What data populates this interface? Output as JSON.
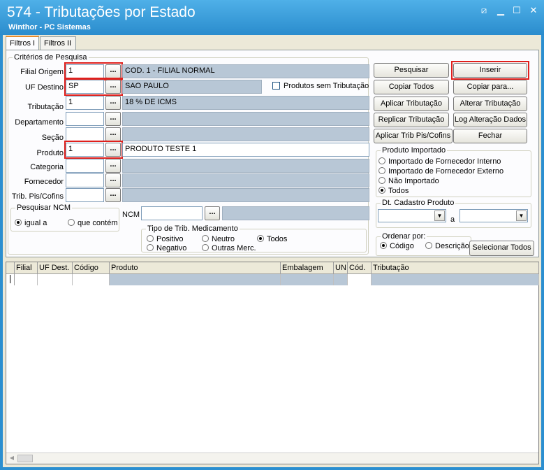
{
  "window": {
    "title": "574 - Tributações por Estado",
    "subtitle": "Winthor - PC Sistemas",
    "restore_icon": "restore-icon",
    "minimize_icon": "minimize-icon",
    "maximize_icon": "maximize-icon",
    "close_icon": "close-icon"
  },
  "tabs": [
    {
      "label": "Filtros I",
      "active": true
    },
    {
      "label": "Filtros II",
      "active": false
    }
  ],
  "criterios": {
    "group_label": "Critérios de Pesquisa",
    "filial_origem": {
      "label": "Filial Origem",
      "value": "1",
      "desc": "COD. 1 - FILIAL NORMAL"
    },
    "uf_destino": {
      "label": "UF Destino",
      "value": "SP",
      "desc": "SAO PAULO"
    },
    "produtos_sem_trib": "Produtos sem Tributação",
    "tributacao": {
      "label": "Tributação",
      "value": "1",
      "desc": "18 % DE ICMS"
    },
    "departamento": {
      "label": "Departamento",
      "value": "",
      "desc": ""
    },
    "secao": {
      "label": "Seção",
      "value": "",
      "desc": ""
    },
    "produto": {
      "label": "Produto",
      "value": "1",
      "desc": "PRODUTO TESTE 1"
    },
    "categoria": {
      "label": "Categoria",
      "value": "",
      "desc": ""
    },
    "fornecedor": {
      "label": "Fornecedor",
      "value": "",
      "desc": ""
    },
    "trib_pis": {
      "label": "Trib. Pis/Cofins",
      "value": "",
      "desc": ""
    },
    "ellipsis": "..."
  },
  "pesquisar_ncm": {
    "label": "Pesquisar NCM",
    "igual": "igual a",
    "contem": "que contém",
    "ncm_label": "NCM",
    "ncm_value": ""
  },
  "tipo_trib": {
    "label": "Tipo de Trib. Medicamento",
    "positivo": "Positivo",
    "neutro": "Neutro",
    "todos": "Todos",
    "negativo": "Negativo",
    "outras": "Outras Merc."
  },
  "buttons": {
    "pesquisar": "Pesquisar",
    "inserir": "Inserir",
    "copiar_todos": "Copiar Todos",
    "copiar_para": "Copiar para...",
    "aplicar_trib": "Aplicar Tributação",
    "alterar_trib": "Alterar Tributação",
    "replicar_trib": "Replicar Tributação",
    "log_alteracao": "Log Alteração Dados",
    "aplicar_pis": "Aplicar Trib Pis/Cofins",
    "fechar": "Fechar",
    "selecionar_todos": "Selecionar Todos"
  },
  "produto_importado": {
    "label": "Produto Importado",
    "opt1": "Importado de Fornecedor Interno",
    "opt2": "Importado de Fornecedor Externo",
    "opt3": "Não Importado",
    "opt4": "Todos"
  },
  "dt_cadastro": {
    "label": "Dt. Cadastro Produto",
    "a": "a"
  },
  "ordenar": {
    "label": "Ordenar por:",
    "codigo": "Código",
    "descricao": "Descrição"
  },
  "grid": {
    "columns": [
      "Filial",
      "UF Dest.",
      "Código",
      "Produto",
      "Embalagem",
      "UN",
      "Cód.",
      "Tributação"
    ]
  }
}
